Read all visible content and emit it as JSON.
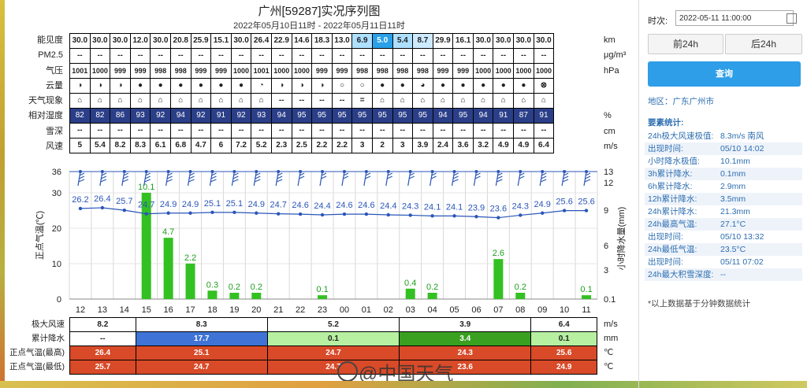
{
  "header": {
    "title": "广州[59287]实况序列图",
    "subtitle": "2022年05月10日11时 - 2022年05月11日11时"
  },
  "hours": [
    "12",
    "13",
    "14",
    "15",
    "16",
    "17",
    "18",
    "19",
    "20",
    "21",
    "22",
    "23",
    "00",
    "01",
    "02",
    "03",
    "04",
    "05",
    "06",
    "07",
    "08",
    "09",
    "10",
    "11"
  ],
  "rows": {
    "labels": [
      "能见度",
      "PM2.5",
      "气压",
      "云量",
      "天气现象",
      "相对湿度",
      "雪深",
      "风速"
    ],
    "units": [
      "km",
      "μg/m³",
      "hPa",
      "",
      "",
      "%",
      "cm",
      "m/s"
    ],
    "visibility": [
      "30.0",
      "30.0",
      "30.0",
      "12.0",
      "30.0",
      "20.8",
      "25.9",
      "15.1",
      "30.0",
      "26.4",
      "22.9",
      "14.6",
      "18.3",
      "13.0",
      "6.9",
      "5.0",
      "5.4",
      "8.7",
      "29.9",
      "16.1",
      "30.0",
      "30.0",
      "30.0",
      "30.0"
    ],
    "pm25": [
      "--",
      "--",
      "--",
      "--",
      "--",
      "--",
      "--",
      "--",
      "--",
      "--",
      "--",
      "--",
      "--",
      "--",
      "--",
      "--",
      "--",
      "--",
      "--",
      "--",
      "--",
      "--",
      "--",
      "--"
    ],
    "pressure": [
      "1001",
      "1000",
      "999",
      "999",
      "998",
      "998",
      "999",
      "999",
      "1000",
      "1001",
      "1000",
      "1000",
      "999",
      "999",
      "998",
      "998",
      "998",
      "998",
      "999",
      "999",
      "1000",
      "1000",
      "1000",
      "1000"
    ],
    "cloud": [
      "◑",
      "◑",
      "◑",
      "●",
      "●",
      "●",
      "●",
      "●",
      "●",
      "◔",
      "◑",
      "◑",
      "◑",
      "○",
      "○",
      "●",
      "●",
      "◕",
      "●",
      "●",
      "●",
      "●",
      "●",
      "⊗"
    ],
    "weather": [
      "⌂",
      "⌂",
      "⌂",
      "⌂",
      "⌂",
      "⌂",
      "⌂",
      "⌂",
      "⌂",
      "⌂",
      "--",
      "--",
      "--",
      "--",
      "=",
      "⌂",
      "⌂",
      "⌂",
      "⌂",
      "⌂",
      "⌂",
      "⌂",
      "⌂",
      "⌂"
    ],
    "humidity": [
      "82",
      "82",
      "86",
      "93",
      "92",
      "94",
      "92",
      "91",
      "92",
      "93",
      "94",
      "95",
      "95",
      "95",
      "95",
      "95",
      "95",
      "95",
      "94",
      "95",
      "94",
      "91",
      "87",
      "91"
    ],
    "snow": [
      "--",
      "--",
      "--",
      "--",
      "--",
      "--",
      "--",
      "--",
      "--",
      "--",
      "--",
      "--",
      "--",
      "--",
      "--",
      "--",
      "--",
      "--",
      "--",
      "--",
      "--",
      "--",
      "--",
      "--"
    ],
    "wind": [
      "5",
      "5.4",
      "8.2",
      "8.3",
      "6.1",
      "6.8",
      "4.7",
      "6",
      "7.2",
      "5.2",
      "2.3",
      "2.5",
      "2.2",
      "2.2",
      "3",
      "2",
      "3",
      "3.9",
      "2.4",
      "3.6",
      "3.2",
      "4.9",
      "4.9",
      "6.4"
    ]
  },
  "chart_data": {
    "type": "bar",
    "categories": [
      "12",
      "13",
      "14",
      "15",
      "16",
      "17",
      "18",
      "19",
      "20",
      "21",
      "22",
      "23",
      "00",
      "01",
      "02",
      "03",
      "04",
      "05",
      "06",
      "07",
      "08",
      "09",
      "10",
      "11"
    ],
    "series": [
      {
        "name": "",
        "kind": "line",
        "values": [
          26.2,
          26.4,
          25.7,
          24.7,
          24.9,
          24.9,
          25.1,
          25.1,
          24.9,
          24.7,
          24.6,
          24.4,
          24.6,
          24.6,
          24.4,
          24.3,
          24.1,
          24.1,
          23.9,
          23.6,
          24.3,
          24.9,
          25.6,
          25.6
        ]
      },
      {
        "name": "",
        "kind": "bar",
        "values": [
          0,
          0,
          0,
          10.1,
          4.7,
          2.2,
          0.3,
          0.2,
          0.2,
          0,
          0,
          0.1,
          0,
          0,
          0,
          0.4,
          0.2,
          0,
          0,
          2.6,
          0.2,
          0,
          0,
          0.1
        ]
      }
    ],
    "bar_labels": [
      "",
      "",
      "",
      "10.1",
      "4.7",
      "2.2",
      "0.3",
      "0.2",
      "0.2",
      "",
      "",
      "0.1",
      "",
      "",
      "",
      "0.4",
      "0.2",
      "",
      "",
      "2.6",
      "0.2",
      "",
      "",
      "0.1"
    ],
    "wind_speed_level": [
      3,
      3,
      3,
      5,
      4,
      4,
      3,
      4,
      4,
      3,
      2,
      2,
      2,
      2,
      2,
      2,
      2,
      3,
      2,
      3,
      2,
      3,
      3,
      4
    ],
    "ylabel_left": "正点气温(℃)",
    "ylabel_right": "小时降水量(mm)",
    "left_ticks": [
      "0",
      "10",
      "20",
      "30",
      "36"
    ],
    "right_ticks": [
      "0.1",
      "3",
      "6",
      "9",
      "12",
      "13"
    ],
    "ylim_left": [
      0,
      36
    ],
    "colors": {
      "temp_line": "#2a56b8",
      "bar": "#33c022",
      "bar_text": "#1e9e1e",
      "temp_text": "#2a56b8"
    }
  },
  "bottom": {
    "labels": [
      "极大风速",
      "累计降水",
      "正点气温(最高)",
      "正点气温(最低)"
    ],
    "units": [
      "m/s",
      "mm",
      "℃",
      "℃"
    ],
    "max_wind": [
      "8.2",
      "8.3",
      "5.2",
      "3.9",
      "6.4"
    ],
    "precip": [
      "--",
      "17.7",
      "0.1",
      "3.4",
      "0.1"
    ],
    "temp_max": [
      "26.4",
      "25.1",
      "24.7",
      "24.3",
      "25.6"
    ],
    "temp_min": [
      "25.7",
      "24.7",
      "24.7",
      "23.6",
      "24.9"
    ],
    "spans": [
      3,
      6,
      6,
      6,
      3
    ]
  },
  "watermark": "@中国天气",
  "panel": {
    "time_label": "时次:",
    "time_value": "2022-05-11 11:00:00",
    "prev_label": "前24h",
    "next_label": "后24h",
    "query_label": "查询",
    "region": "地区：广东广州市",
    "stats_title": "要素统计:",
    "stats": [
      [
        "24h极大风速极值:",
        "8.3m/s 南风"
      ],
      [
        "出现时间:",
        "05/10 14:02"
      ],
      [
        "小时降水极值:",
        "10.1mm"
      ],
      [
        "3h累计降水:",
        "0.1mm"
      ],
      [
        "6h累计降水:",
        "2.9mm"
      ],
      [
        "12h累计降水:",
        "3.5mm"
      ],
      [
        "24h累计降水:",
        "21.3mm"
      ],
      [
        "24h最高气温:",
        "27.1°C"
      ],
      [
        "出现时间:",
        "05/10 13:32"
      ],
      [
        "24h最低气温:",
        "23.5°C"
      ],
      [
        "出现时间:",
        "05/11 07:02"
      ],
      [
        "24h最大积雪深度:",
        "--"
      ]
    ],
    "note": "*以上数据基于分钟数据统计"
  }
}
